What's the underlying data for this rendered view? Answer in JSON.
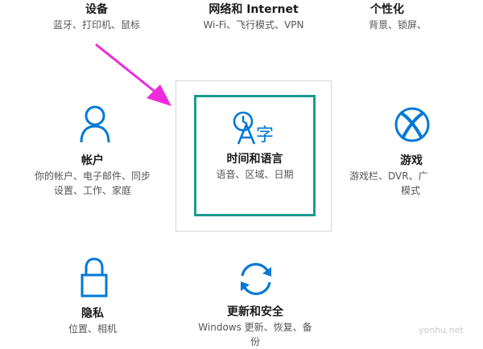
{
  "tiles": {
    "devices": {
      "title": "设备",
      "desc": "蓝牙、打印机、鼠标"
    },
    "network": {
      "title": "网络和 Internet",
      "desc": "Wi-Fi、飞行模式、VPN"
    },
    "personalization": {
      "title": "个性化",
      "desc": "背景、锁屏、"
    },
    "accounts": {
      "title": "帐户",
      "desc_line1": "你的帐户、电子邮件、同步",
      "desc_line2": "设置、工作、家庭"
    },
    "time_language": {
      "title": "时间和语言",
      "desc": "语音、区域、日期"
    },
    "gaming": {
      "title": "游戏",
      "desc_line1": "游戏栏、DVR、广",
      "desc_line2": "模式"
    },
    "privacy": {
      "title": "隐私",
      "desc": "位置、相机"
    },
    "update_security": {
      "title": "更新和安全",
      "desc_line1": "Windows 更新、恢复、备",
      "desc_line2": "份"
    }
  },
  "icons": {
    "accounts": "person-icon",
    "time_language": "time-language-icon",
    "gaming": "xbox-icon",
    "privacy": "lock-icon",
    "update_security": "sync-icon",
    "annotation": "pink-arrow-icon"
  },
  "colors": {
    "icon_blue": "#0078d7",
    "focus_border": "#1b9a8e",
    "arrow_pink": "#ee2bdc"
  },
  "watermark": "yonhu.net"
}
